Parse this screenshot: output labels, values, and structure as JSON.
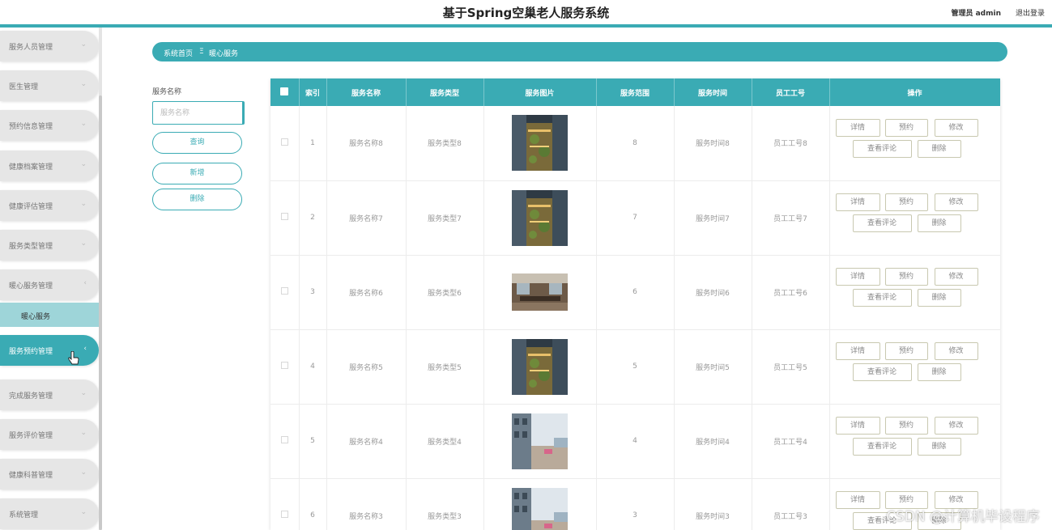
{
  "header": {
    "title": "基于Spring空巢老人服务系统",
    "user": "管理员 admin",
    "logout": "退出登录"
  },
  "sidebar": {
    "items": [
      {
        "label": "服务人员管理"
      },
      {
        "label": "医生管理"
      },
      {
        "label": "预约信息管理"
      },
      {
        "label": "健康档案管理"
      },
      {
        "label": "健康评估管理"
      },
      {
        "label": "服务类型管理"
      },
      {
        "label": "暖心服务管理"
      },
      {
        "label": "服务预约管理"
      },
      {
        "label": "完成服务管理"
      },
      {
        "label": "服务评价管理"
      },
      {
        "label": "健康科普管理"
      },
      {
        "label": "系统管理"
      }
    ],
    "submenu_label": "暖心服务",
    "chevron_down": "⌄",
    "chevron_left": "‹"
  },
  "breadcrumb": {
    "home": "系统首页",
    "separator": "Ξ",
    "current": "暖心服务"
  },
  "search": {
    "label": "服务名称",
    "placeholder": "服务名称",
    "query_button": "查询",
    "add_button": "新增",
    "delete_button": "删除"
  },
  "table": {
    "headers": [
      "索引",
      "服务名称",
      "服务类型",
      "服务图片",
      "服务范围",
      "服务时间",
      "员工工号",
      "操作"
    ],
    "rows": [
      {
        "index": "1",
        "name": "服务名称8",
        "type": "服务类型8",
        "scope": "8",
        "time": "服务时间8",
        "staff": "员工工号8",
        "image": "courtyard"
      },
      {
        "index": "2",
        "name": "服务名称7",
        "type": "服务类型7",
        "scope": "7",
        "time": "服务时间7",
        "staff": "员工工号7",
        "image": "courtyard"
      },
      {
        "index": "3",
        "name": "服务名称6",
        "type": "服务类型6",
        "scope": "6",
        "time": "服务时间6",
        "staff": "员工工号6",
        "image": "interior"
      },
      {
        "index": "4",
        "name": "服务名称5",
        "type": "服务类型5",
        "scope": "5",
        "time": "服务时间5",
        "staff": "员工工号5",
        "image": "courtyard"
      },
      {
        "index": "5",
        "name": "服务名称4",
        "type": "服务类型4",
        "scope": "4",
        "time": "服务时间4",
        "staff": "员工工号4",
        "image": "walkway"
      },
      {
        "index": "6",
        "name": "服务名称3",
        "type": "服务类型3",
        "scope": "3",
        "time": "服务时间3",
        "staff": "员工工号3",
        "image": "walkway"
      }
    ],
    "actions": {
      "detail": "详情",
      "book": "预约",
      "edit": "修改",
      "review": "查看评论",
      "delete": "删除"
    }
  },
  "watermark": "CSDN @计算机毕设程序",
  "colors": {
    "accent": "#3aabb4",
    "submenu": "#9ed5d9",
    "menu_bg": "#e6e6e6"
  }
}
